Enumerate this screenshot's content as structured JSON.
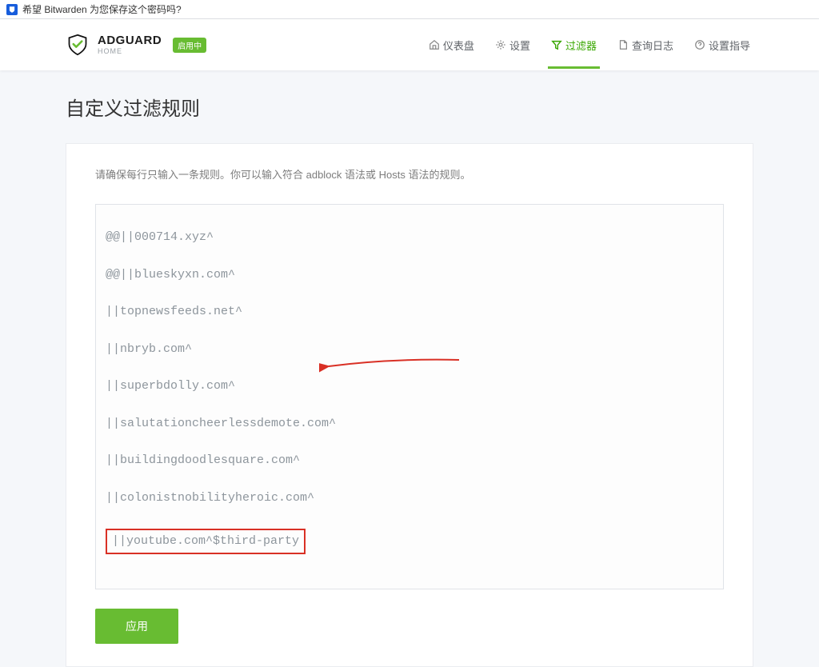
{
  "browser": {
    "notification": "希望 Bitwarden 为您保存这个密码吗?"
  },
  "brand": {
    "name": "ADGUARD",
    "subtitle": "HOME",
    "status_badge": "启用中"
  },
  "nav": {
    "dashboard": "仪表盘",
    "settings": "设置",
    "filters": "过滤器",
    "query_logs": "查询日志",
    "setup_guide": "设置指导"
  },
  "page": {
    "title": "自定义过滤规则",
    "hint": "请确保每行只输入一条规则。你可以输入符合 adblock 语法或 Hosts 语法的规则。"
  },
  "rules": {
    "line1": "@@||000714.xyz^",
    "line2": "@@||blueskyxn.com^",
    "line3": "||topnewsfeeds.net^",
    "line4": "||nbryb.com^",
    "line5": "||superbdolly.com^",
    "line6": "||salutationcheerlessdemote.com^",
    "line7": "||buildingdoodlesquare.com^",
    "line8": "||colonistnobilityheroic.com^",
    "highlighted": "||youtube.com^$third-party"
  },
  "buttons": {
    "apply": "应用"
  },
  "colors": {
    "accent": "#68bc32",
    "highlight": "#d93025"
  }
}
